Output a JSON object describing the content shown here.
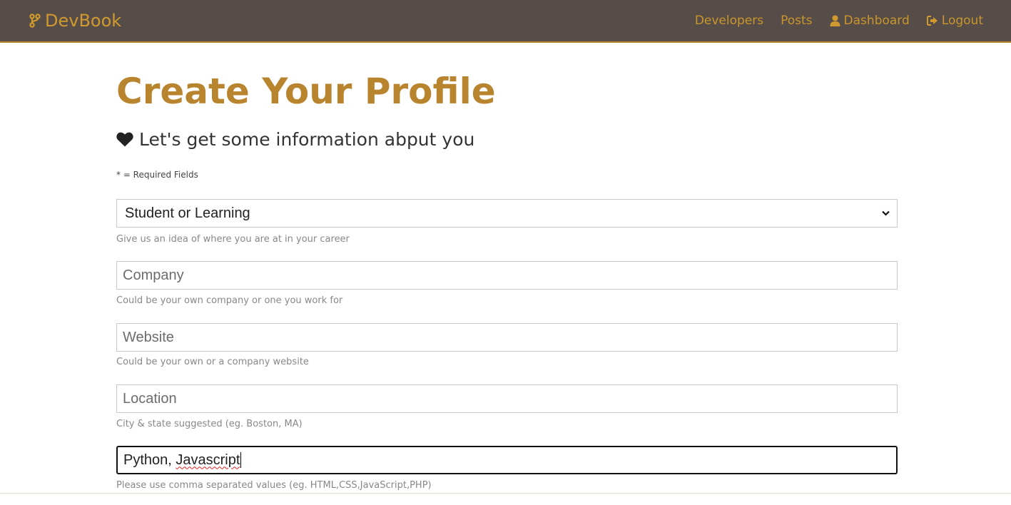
{
  "brand": {
    "name": "DevBook",
    "icon": "code-branch-icon",
    "color": "#d09a2f"
  },
  "nav": {
    "background": "#574d48",
    "items": [
      {
        "label": "Developers",
        "icon": ""
      },
      {
        "label": "Posts",
        "icon": ""
      },
      {
        "label": "Dashboard",
        "icon": "user-icon"
      },
      {
        "label": "Logout",
        "icon": "sign-out-icon"
      }
    ]
  },
  "page": {
    "title": "Create Your Profile",
    "lead": "Let's get some information abput you",
    "lead_icon": "heart-icon",
    "required_note": "* = Required Fields"
  },
  "form": {
    "status": {
      "value": "Student or Learning",
      "hint": "Give us an idea of where you are at in your career"
    },
    "company": {
      "placeholder": "Company",
      "hint": "Could be your own company or one you work for"
    },
    "website": {
      "placeholder": "Website",
      "hint": "Could be your own or a company website"
    },
    "location": {
      "placeholder": "Location",
      "hint": "City & state suggested (eg. Boston, MA)"
    },
    "skills": {
      "value_part1": "Python, ",
      "value_part2": "Javascript",
      "hint": "Please use comma separated values (eg. HTML,CSS,JavaScript,PHP)"
    }
  },
  "colors": {
    "accent": "#b8842e",
    "nav_text": "#c9952c"
  }
}
